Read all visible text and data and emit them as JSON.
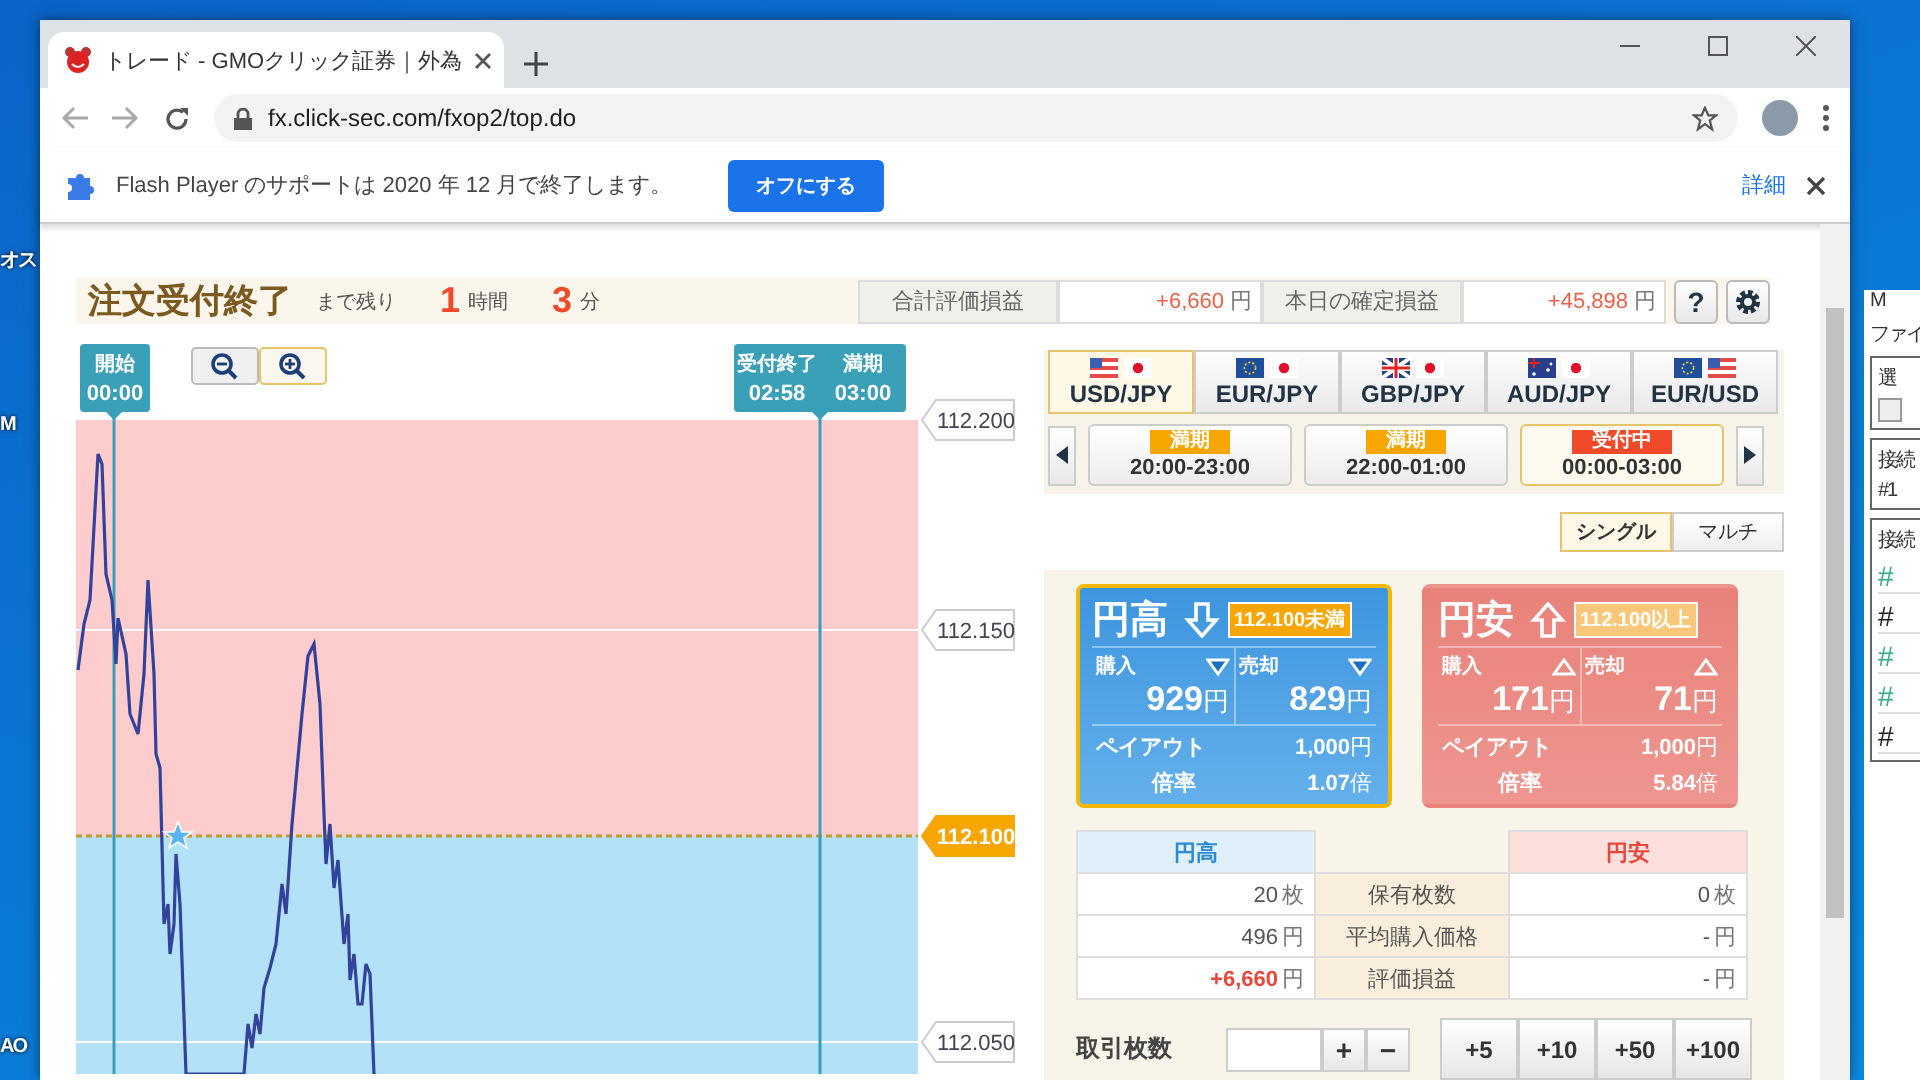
{
  "desktop": {
    "left_labels": [
      "オス",
      "M",
      "AO"
    ],
    "side_window": {
      "title": "M",
      "menu": "ファイ",
      "group_1": "選",
      "group_1_checkbox": {
        "checked": false
      },
      "group_2": "接続",
      "group_2_item": "#1",
      "group_3": "接続",
      "group_3_items": [
        "#",
        "#",
        "#",
        "#",
        "#"
      ]
    }
  },
  "browser": {
    "tab_title": "トレード - GMOクリック証券｜外為",
    "url": "fx.click-sec.com/fxop2/top.do",
    "infobar": {
      "message": "Flash Player のサポートは 2020 年 12 月で終了します。",
      "button": "オフにする",
      "link": "詳細"
    }
  },
  "header": {
    "title": "注文受付終了",
    "remaining_label": "まで残り",
    "countdown": [
      {
        "value": "1",
        "unit": "時間"
      },
      {
        "value": "3",
        "unit": "分"
      }
    ],
    "summary": [
      {
        "label": "合計評価損益",
        "value": "+6,660",
        "unit": "円"
      },
      {
        "label": "本日の確定損益",
        "value": "+45,898",
        "unit": "円"
      }
    ],
    "help_button": "?"
  },
  "chart": {
    "zoom_buttons": [
      {
        "kind": "zoom-out",
        "selected": false
      },
      {
        "kind": "zoom-in",
        "selected": true
      }
    ],
    "callouts": [
      {
        "columns": [
          {
            "label": "開始",
            "time": "00:00"
          }
        ]
      },
      {
        "columns": [
          {
            "label": "受付終了",
            "time": "02:58"
          },
          {
            "label": "満期",
            "time": "03:00"
          }
        ]
      }
    ],
    "price_labels": [
      {
        "text": "112.200",
        "kind": "tick"
      },
      {
        "text": "112.150",
        "kind": "tick"
      },
      {
        "text": "112.100",
        "kind": "strike"
      },
      {
        "text": "112.050",
        "kind": "tick"
      }
    ]
  },
  "currency_tabs": [
    {
      "label": "USD/JPY",
      "flags": [
        {
          "kind": "us"
        },
        {
          "kind": "jp"
        }
      ],
      "selected": true
    },
    {
      "label": "EUR/JPY",
      "flags": [
        {
          "kind": "eu"
        },
        {
          "kind": "jp"
        }
      ],
      "selected": false
    },
    {
      "label": "GBP/JPY",
      "flags": [
        {
          "kind": "gb"
        },
        {
          "kind": "jp"
        }
      ],
      "selected": false
    },
    {
      "label": "AUD/JPY",
      "flags": [
        {
          "kind": "au"
        },
        {
          "kind": "jp"
        }
      ],
      "selected": false
    },
    {
      "label": "EUR/USD",
      "flags": [
        {
          "kind": "eu"
        },
        {
          "kind": "us"
        }
      ],
      "selected": false
    }
  ],
  "periods": [
    {
      "badge": "満期",
      "color": "#f7a600",
      "time": "20:00-23:00",
      "selected": false
    },
    {
      "badge": "満期",
      "color": "#f7a600",
      "time": "22:00-01:00",
      "selected": false
    },
    {
      "badge": "受付中",
      "color": "#f04a2a",
      "time": "00:00-03:00",
      "selected": true
    }
  ],
  "modes": [
    {
      "label": "シングル",
      "selected": true
    },
    {
      "label": "マルチ",
      "selected": false
    }
  ],
  "option_cards": [
    {
      "kind": "yen-high",
      "title": "円高",
      "threshold": "112.100未満",
      "selected": true,
      "buy": {
        "label": "購入",
        "price": "929",
        "unit": "円"
      },
      "sell": {
        "label": "売却",
        "price": "829",
        "unit": "円"
      },
      "payout": {
        "label": "ペイアウト",
        "value": "1,000",
        "unit": "円"
      },
      "rate": {
        "label": "倍率",
        "value": "1.07",
        "unit": "倍"
      }
    },
    {
      "kind": "yen-low",
      "title": "円安",
      "threshold": "112.100以上",
      "selected": false,
      "buy": {
        "label": "購入",
        "price": "171",
        "unit": "円"
      },
      "sell": {
        "label": "売却",
        "price": "71",
        "unit": "円"
      },
      "payout": {
        "label": "ペイアウト",
        "value": "1,000",
        "unit": "円"
      },
      "rate": {
        "label": "倍率",
        "value": "5.84",
        "unit": "倍"
      }
    }
  ],
  "positions": {
    "high_header": "円高",
    "low_header": "円安",
    "rows": [
      {
        "label": "保有枚数",
        "high": {
          "value": "20",
          "unit": "枚",
          "kind": "plain"
        },
        "low": {
          "value": "0",
          "unit": "枚",
          "kind": "plain"
        }
      },
      {
        "label": "平均購入価格",
        "high": {
          "value": "496",
          "unit": "円",
          "kind": "plain"
        },
        "low": {
          "value": "-",
          "unit": "円",
          "kind": "plain"
        }
      },
      {
        "label": "評価損益",
        "high": {
          "value": "+6,660",
          "unit": "円",
          "kind": "profit"
        },
        "low": {
          "value": "-",
          "unit": "円",
          "kind": "plain"
        }
      }
    ]
  },
  "quantity": {
    "label": "取引枚数",
    "plus": "+",
    "minus": "−",
    "presets": [
      "+5",
      "+10",
      "+50",
      "+100"
    ]
  }
}
